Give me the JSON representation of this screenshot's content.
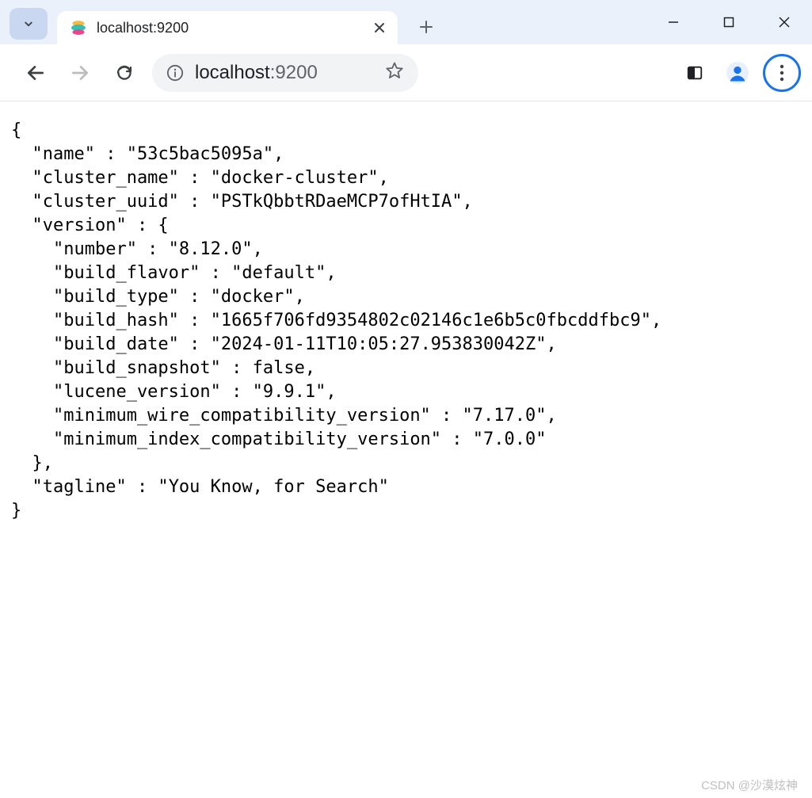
{
  "tab": {
    "title": "localhost:9200"
  },
  "address": {
    "host": "localhost",
    "port": ":9200"
  },
  "content": {
    "name": "53c5bac5095a",
    "cluster_name": "docker-cluster",
    "cluster_uuid": "PSTkQbbtRDaeMCP7ofHtIA",
    "version": {
      "number": "8.12.0",
      "build_flavor": "default",
      "build_type": "docker",
      "build_hash": "1665f706fd9354802c02146c1e6b5c0fbcddfbc9",
      "build_date": "2024-01-11T10:05:27.953830042Z",
      "build_snapshot": "false",
      "lucene_version": "9.9.1",
      "minimum_wire_compatibility_version": "7.17.0",
      "minimum_index_compatibility_version": "7.0.0"
    },
    "tagline": "You Know, for Search"
  },
  "watermark": "CSDN @沙漠炫神"
}
